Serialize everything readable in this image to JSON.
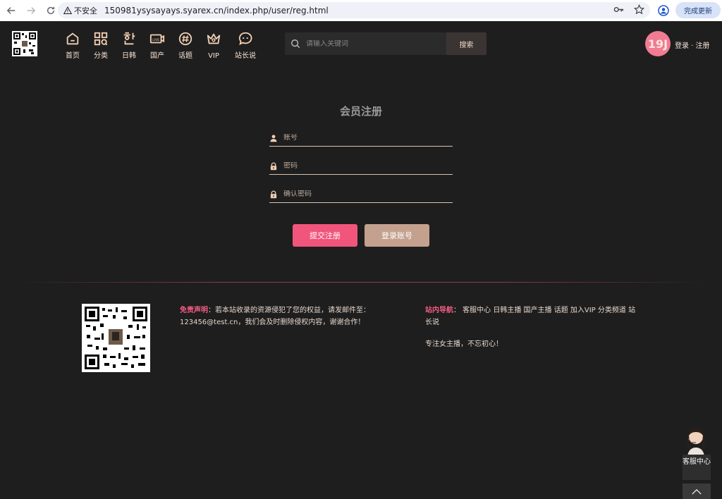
{
  "browser": {
    "security_label": "不安全",
    "url": "150981ysysayays.syarex.cn/index.php/user/reg.html",
    "update_label": "完成更新"
  },
  "header": {
    "nav": [
      {
        "label": "首页",
        "icon": "home-icon"
      },
      {
        "label": "分类",
        "icon": "category-icon"
      },
      {
        "label": "日韩",
        "icon": "hangul-icon"
      },
      {
        "label": "国产",
        "icon": "live-icon"
      },
      {
        "label": "话题",
        "icon": "hashtag-icon"
      },
      {
        "label": "VIP",
        "icon": "crown-icon"
      },
      {
        "label": "站长说",
        "icon": "chat-icon"
      }
    ],
    "search_placeholder": "请输入关键词",
    "search_button": "搜索",
    "avatar_text": "19J",
    "auth_links": "登录 · 注册"
  },
  "register": {
    "title": "会员注册",
    "account_placeholder": "账号",
    "password_placeholder": "密码",
    "confirm_placeholder": "确认密码",
    "submit_label": "提交注册",
    "login_label": "登录账号"
  },
  "footer": {
    "disclaimer_label": "免责声明",
    "disclaimer_text": "：若本站收录的资源侵犯了您的权益，请发邮件至：123456@test.cn，我们会及时删除侵权内容，谢谢合作！",
    "nav_label": "站内导航",
    "nav_text": "：  客服中心 日韩主播 国产主播 话题 加入VIP 分类频道 站长说",
    "slogan": "专注女主播，不忘初心！"
  },
  "service": {
    "label": "客服中心"
  },
  "colors": {
    "accent_pink": "#f1557b",
    "accent_tan": "#c3a18e",
    "background": "#1e1e1e",
    "nav_icon": "#f3cfb3"
  }
}
